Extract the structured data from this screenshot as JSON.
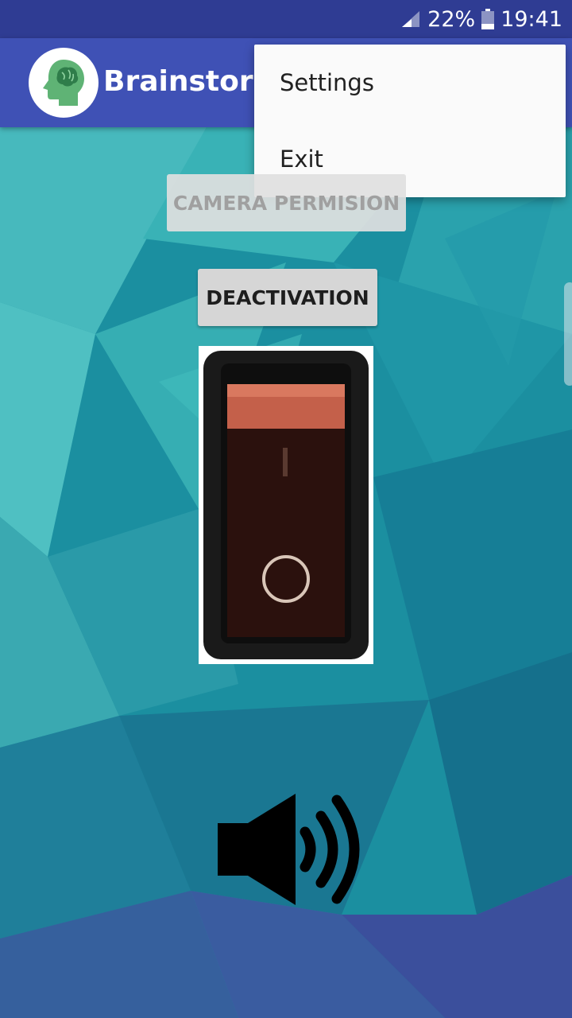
{
  "status_bar": {
    "battery": "22%",
    "time": "19:41"
  },
  "app_bar": {
    "title": "Brainstorm",
    "logo_icon": "brain-head-icon"
  },
  "overflow_menu": {
    "items": [
      "Settings",
      "Exit"
    ]
  },
  "buttons": {
    "camera_permission": "CAMERA PERMISION",
    "deactivation": "DEACTIVATION"
  },
  "switch": {
    "icon": "rocker-switch-icon",
    "state": "off"
  },
  "sound": {
    "icon": "speaker-volume-icon"
  },
  "colors": {
    "status_bar": "#2f3c93",
    "app_bar": "#3f51b5",
    "logo_green": "#5fb375"
  }
}
